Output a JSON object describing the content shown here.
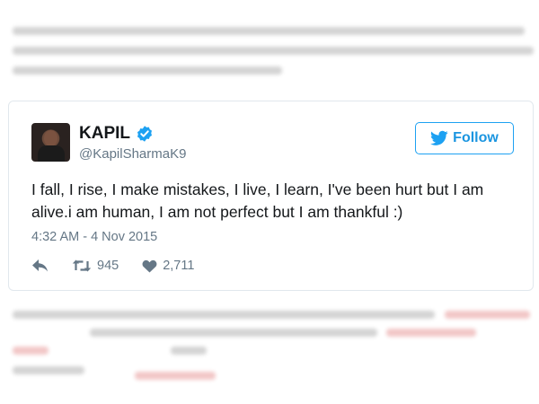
{
  "tweet": {
    "name": "KAPIL",
    "handle": "@KapilSharmaK9",
    "follow_label": "Follow",
    "text": "I fall, I rise, I make mistakes, I live, I learn, I've been hurt but I am alive.i am human, I am not perfect but I am thankful :)",
    "timestamp": "4:32 AM - 4 Nov 2015",
    "retweets": "945",
    "likes": "2,711"
  },
  "icons": {
    "avatar": "profile-photo",
    "verified": "verified-badge-icon",
    "follow": "twitter-bird-icon",
    "reply": "reply-arrow-icon",
    "retweet": "retweet-icon",
    "like": "heart-icon"
  },
  "colors": {
    "accent": "#1da1f2",
    "text": "#14171a",
    "muted": "#657786",
    "border": "#e1e8ed"
  }
}
